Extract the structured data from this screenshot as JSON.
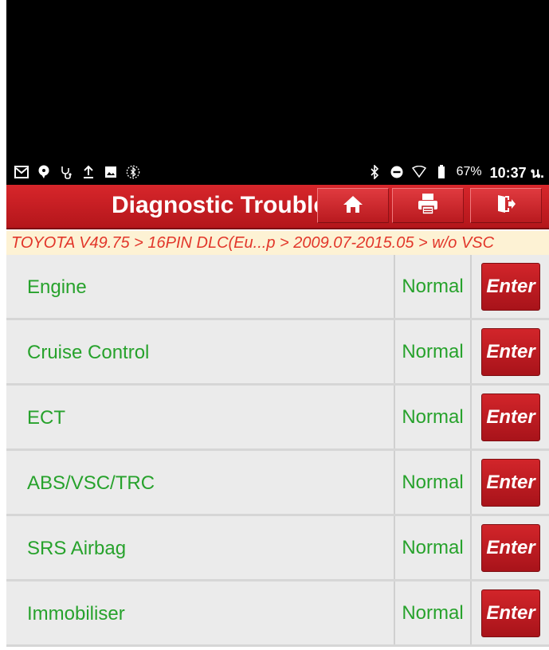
{
  "statusbar": {
    "left_icons": [
      "mail-icon",
      "chat-icon",
      "stethoscope-icon",
      "upload-icon",
      "image-icon",
      "bluetooth-circle-icon"
    ],
    "right_icons": [
      "bluetooth-icon",
      "do-not-disturb-icon",
      "wifi-icon",
      "battery-icon"
    ],
    "battery_percent": "67%",
    "time": "10:37 น."
  },
  "titlebar": {
    "title": "Diagnostic Trouble Code",
    "buttons": [
      "home-icon",
      "print-icon",
      "exit-icon"
    ]
  },
  "breadcrumb": "TOYOTA V49.75 > 16PIN DLC(Eu...p > 2009.07-2015.05 > w/o VSC",
  "systems": [
    {
      "name": "Engine",
      "status": "Normal",
      "action": "Enter"
    },
    {
      "name": "Cruise Control",
      "status": "Normal",
      "action": "Enter"
    },
    {
      "name": "ECT",
      "status": "Normal",
      "action": "Enter"
    },
    {
      "name": "ABS/VSC/TRC",
      "status": "Normal",
      "action": "Enter"
    },
    {
      "name": "SRS Airbag",
      "status": "Normal",
      "action": "Enter"
    },
    {
      "name": "Immobiliser",
      "status": "Normal",
      "action": "Enter"
    }
  ],
  "colors": {
    "header_red": "#c41e23",
    "status_green": "#27a22c",
    "breadcrumb_bg": "#fdf2d4",
    "breadcrumb_text": "#e2362a",
    "row_bg": "#ebebeb"
  }
}
